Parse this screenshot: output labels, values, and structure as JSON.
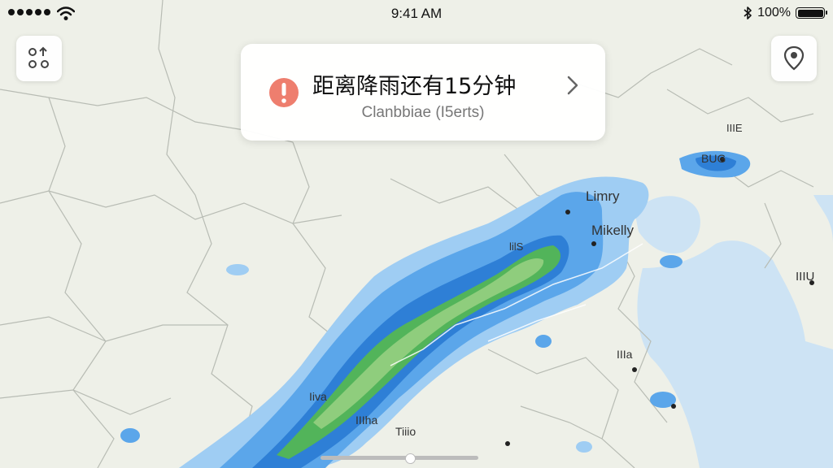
{
  "status_bar": {
    "time": "9:41 AM",
    "battery_text": "100%",
    "battery_level": 1.0,
    "icons": [
      "signal-dots-icon",
      "wifi-icon",
      "bluetooth-icon",
      "battery-icon"
    ]
  },
  "controls": {
    "left_button_icon": "layers-icon",
    "right_button_icon": "location-pin-icon"
  },
  "alert": {
    "title": "距离降雨还有15分钟",
    "subtitle": "Clanbbiae (I5erts)",
    "icon": "warning-icon",
    "icon_color": "#ee7e6e",
    "action_icon": "chevron-right-icon"
  },
  "map_labels": {
    "limry": "Limry",
    "mikelly": "Mikelly",
    "bug": "BUG",
    "iiie": "IIIE",
    "ilu": "IIIU",
    "liis": "lilS",
    "iiha": "IIIa",
    "liva": "Iiva",
    "iiiha": "IIIha",
    "tiio": "Tiiio"
  },
  "radar_colors": {
    "light_blue": "#9fcdf3",
    "mid_blue": "#5ba6ea",
    "deep_blue": "#2e7fd6",
    "green": "#52b45a",
    "light_green": "#8fcd7d",
    "water": "#cde3f4"
  }
}
